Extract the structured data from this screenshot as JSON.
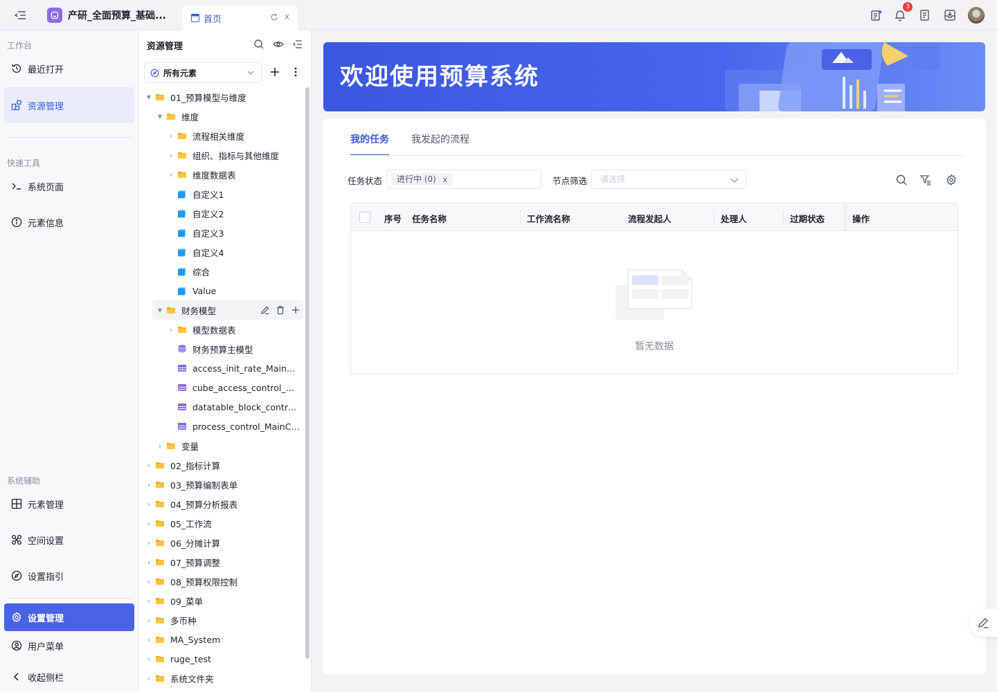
{
  "topbar": {
    "app_name": "产研_全面预算_基础...",
    "tab_label": "首页",
    "tab_close": "x",
    "notification_count": "3"
  },
  "leftnav": {
    "section_workbench": "工作台",
    "recent": "最近打开",
    "resource": "资源管理",
    "section_quick": "快速工具",
    "system_page": "系统页面",
    "element_info": "元素信息",
    "section_aux": "系统辅助",
    "element_mgmt": "元素管理",
    "space_settings": "空间设置",
    "setup_guide": "设置指引",
    "settings_mgmt": "设置管理",
    "user_menu": "用户菜单",
    "collapse_sidebar": "收起侧栏"
  },
  "tree": {
    "header": "资源管理",
    "filter_value": "所有元素",
    "rows": [
      "01_预算模型与维度",
      "维度",
      "流程相关维度",
      "组织、指标与其他维度",
      "维度数据表",
      "自定义1",
      "自定义2",
      "自定义3",
      "自定义4",
      "综合",
      "Value",
      "财务模型",
      "模型数据表",
      "财务预算主模型",
      "access_init_rate_MainCu...",
      "cube_access_control_Ma...",
      "datatable_block_control_...",
      "process_control_MainCube",
      "变量",
      "02_指标计算",
      "03_预算编制表单",
      "04_预算分析报表",
      "05_工作流",
      "06_分摊计算",
      "07_预算调整",
      "08_预算权限控制",
      "09_菜单",
      "多币种",
      "MA_System",
      "ruge_test",
      "系统文件夹"
    ]
  },
  "banner": {
    "title": "欢迎使用预算系统"
  },
  "tasks": {
    "tabs": [
      "我的任务",
      "我发起的流程"
    ],
    "status_label": "任务状态",
    "status_tag": "进行中 (0)",
    "status_tag_close": "x",
    "node_label": "节点筛选",
    "node_placeholder": "请选择",
    "columns": [
      "序号",
      "任务名称",
      "工作流名称",
      "流程发起人",
      "处理人",
      "过期状态",
      "操作"
    ],
    "empty_text": "暂无数据"
  }
}
